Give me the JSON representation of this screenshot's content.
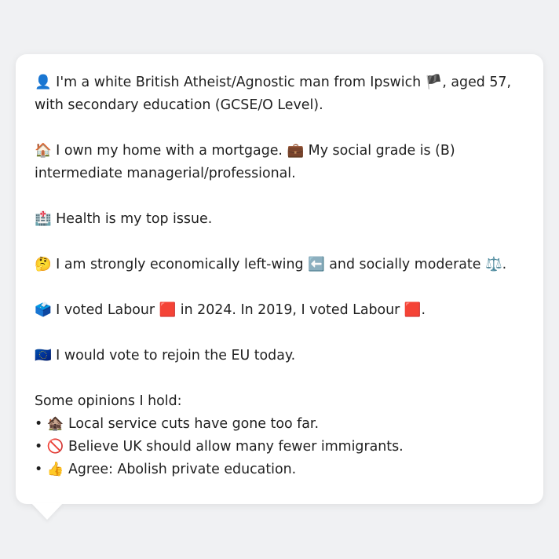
{
  "profile": {
    "identity": {
      "icon": "👤",
      "text_a": " I'm a white British Atheist/Agnostic man from Ipswich ",
      "flag": "🏴",
      "text_b": ", aged 57, with secondary education (GCSE/O Level)."
    },
    "housing": {
      "icon": "🏠",
      "text_a": " I own my home with a mortgage. ",
      "icon2": "💼",
      "text_b": " My social grade is (B) intermediate managerial/professional."
    },
    "issue": {
      "icon": "🏥",
      "text": " Health is my top issue."
    },
    "ideology": {
      "icon": "🤔",
      "text_a": " I am strongly economically left-wing ",
      "icon2": "⬅️",
      "text_b": " and socially moderate ",
      "icon3": "⚖️",
      "text_c": "."
    },
    "votes": {
      "icon": "🗳️",
      "text_a": " I voted Labour ",
      "party_icon_2024": "🟥",
      "text_b": " in 2024. In 2019, I voted Labour ",
      "party_icon_2019": "🟥",
      "text_c": "."
    },
    "eu": {
      "icon": "🇪🇺",
      "text": " I would vote to rejoin the EU today."
    },
    "opinions": {
      "heading": "Some opinions I hold:",
      "items": [
        {
          "bullet": "• ",
          "icon": "🏚️",
          "text": " Local service cuts have gone too far."
        },
        {
          "bullet": "• ",
          "icon": "🚫",
          "text": " Believe UK should allow many fewer immigrants."
        },
        {
          "bullet": "• ",
          "icon": "👍",
          "text": " Agree: Abolish private education."
        }
      ]
    }
  }
}
